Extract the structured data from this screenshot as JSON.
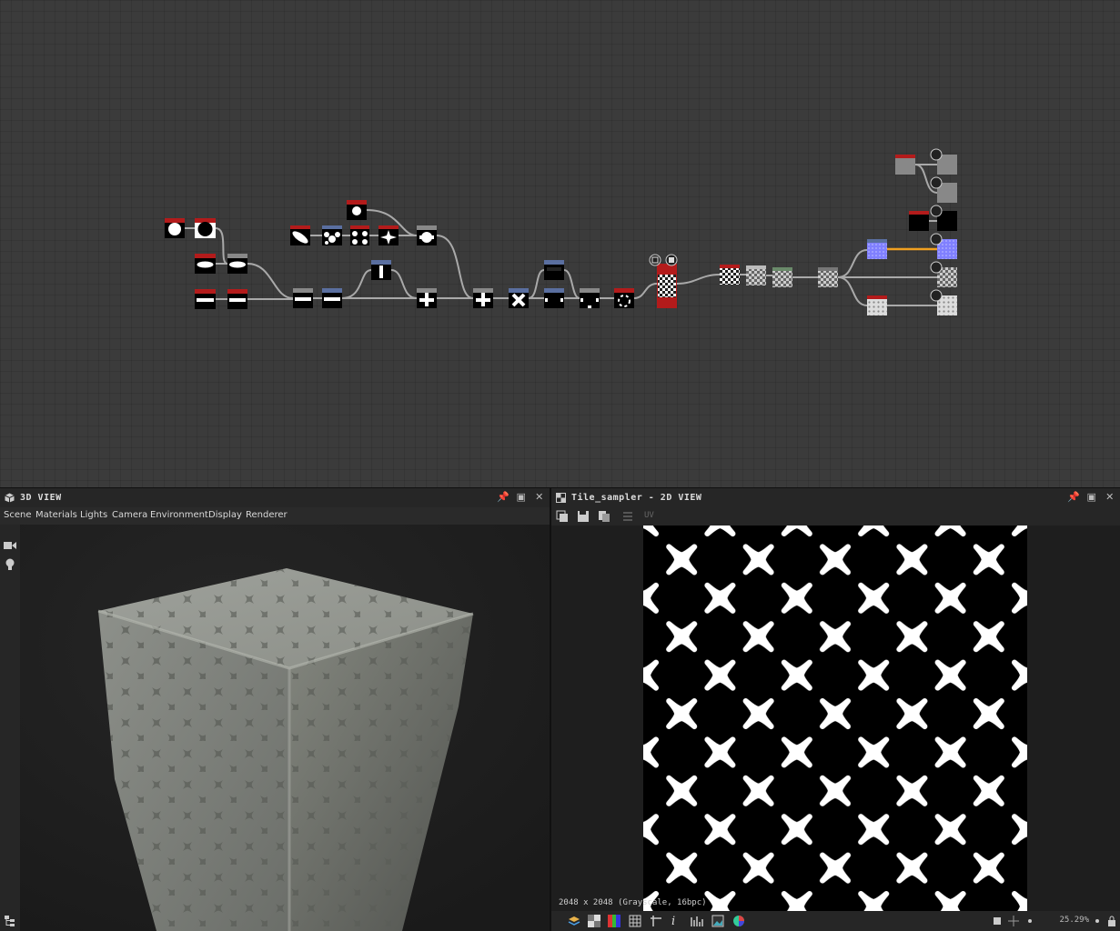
{
  "graph": {
    "nodes": [
      {
        "id": "n1",
        "kind": "circle"
      },
      {
        "id": "n2",
        "kind": "circle"
      },
      {
        "id": "n3",
        "kind": "ellipse"
      },
      {
        "id": "n4",
        "kind": "ellipse"
      },
      {
        "id": "n5",
        "kind": "bar"
      },
      {
        "id": "n6",
        "kind": "bar"
      },
      {
        "id": "n7",
        "kind": "bar"
      },
      {
        "id": "n8",
        "kind": "bar"
      },
      {
        "id": "n9",
        "kind": "vbar"
      },
      {
        "id": "n10",
        "kind": "plus"
      },
      {
        "id": "n11",
        "kind": "plus"
      },
      {
        "id": "n12",
        "kind": "x"
      },
      {
        "id": "n13",
        "kind": "dark"
      },
      {
        "id": "n14",
        "kind": "dark"
      },
      {
        "id": "n15",
        "kind": "dark"
      },
      {
        "id": "n16",
        "kind": "dark"
      },
      {
        "id": "n17",
        "kind": "tile-red"
      },
      {
        "id": "n18",
        "kind": "circle"
      },
      {
        "id": "n19",
        "kind": "leaf"
      },
      {
        "id": "n20",
        "kind": "blob"
      },
      {
        "id": "n21",
        "kind": "blob"
      },
      {
        "id": "n22",
        "kind": "star"
      },
      {
        "id": "n23",
        "kind": "plus"
      },
      {
        "id": "n24",
        "kind": "checker"
      },
      {
        "id": "n25",
        "kind": "checker"
      },
      {
        "id": "n26",
        "kind": "checker-green"
      },
      {
        "id": "n27",
        "kind": "checker-gray"
      },
      {
        "id": "n28",
        "kind": "normal"
      },
      {
        "id": "n29",
        "kind": "checker-white"
      },
      {
        "id": "n30",
        "kind": "gray-red"
      },
      {
        "id": "n31",
        "kind": "black-red"
      },
      {
        "id": "out1",
        "kind": "output-gray"
      },
      {
        "id": "out2",
        "kind": "output-gray"
      },
      {
        "id": "out3",
        "kind": "output-black"
      },
      {
        "id": "out4",
        "kind": "output-normal"
      },
      {
        "id": "out5",
        "kind": "output-checker"
      },
      {
        "id": "out6",
        "kind": "output-white"
      }
    ]
  },
  "view3d": {
    "title": "3D VIEW",
    "menu": [
      "Scene",
      "Materials",
      "Lights",
      "Camera",
      "Environment",
      "Display",
      "Renderer"
    ],
    "side_icons": [
      "camera-icon",
      "light-bulb-icon"
    ],
    "bottom_icon": "hierarchy-icon"
  },
  "view2d": {
    "title": "Tile_sampler - 2D VIEW",
    "toolbar_icons": [
      "copy-icon",
      "save-icon",
      "duplicate-icon",
      "layout-icon"
    ],
    "toolbar_uv_label": "UV",
    "status": "2048 x 2048 (Grayscale, 16bpc)",
    "zoom": "25.29%",
    "bottom_icons": [
      "layers-icon",
      "checker-icon",
      "color-icon",
      "grid-icon",
      "pivot-icon",
      "info-icon",
      "histogram-icon",
      "image-icon",
      "color-wheel-icon"
    ]
  },
  "colors": {
    "accent_red": "#b31b1b",
    "accent_orange": "#f0a020",
    "accent_blue": "#7c7cff",
    "header_blue": "#5a6fa0",
    "background": "#3b3b3b"
  }
}
